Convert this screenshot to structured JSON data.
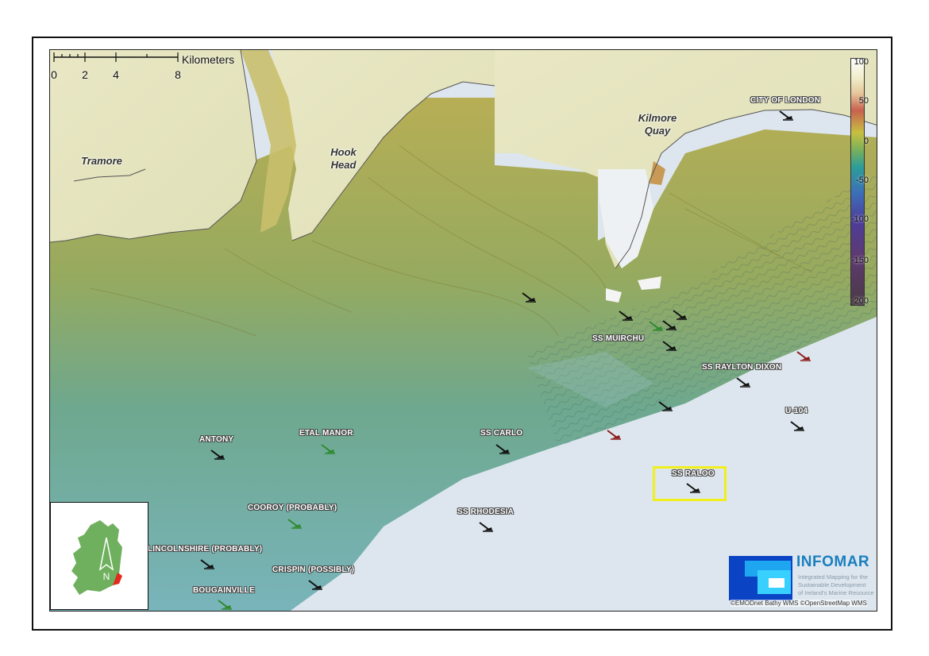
{
  "map": {
    "place_names": [
      {
        "id": "tramore",
        "text": "Tramore"
      },
      {
        "id": "hook-head",
        "text": "Hook\nHead"
      },
      {
        "id": "kilmore-quay",
        "text": "Kilmore\nQuay"
      }
    ],
    "scale": {
      "title": "Kilometers",
      "ticks": [
        "0",
        "2",
        "4",
        "8"
      ]
    },
    "legend": {
      "ticks": [
        "100",
        "50",
        "0",
        "-50",
        "-100",
        "-150",
        "-200"
      ]
    },
    "wrecks": [
      {
        "name": "CITY OF LONDON",
        "status": "black"
      },
      {
        "name": "",
        "status": "black"
      },
      {
        "name": "",
        "status": "black"
      },
      {
        "name": "",
        "status": "green"
      },
      {
        "name": "",
        "status": "black"
      },
      {
        "name": "",
        "status": "black"
      },
      {
        "name": "SS MUIRCHU",
        "status": "black"
      },
      {
        "name": "",
        "status": "red"
      },
      {
        "name": "SS RAYLTON DIXON",
        "status": "black"
      },
      {
        "name": "U-104",
        "status": "black"
      },
      {
        "name": "",
        "status": "black"
      },
      {
        "name": "",
        "status": "red"
      },
      {
        "name": "SS CARLO",
        "status": "black"
      },
      {
        "name": "ETAL MANOR",
        "status": "green"
      },
      {
        "name": "ANTONY",
        "status": "black"
      },
      {
        "name": "SS RALOO",
        "status": "black"
      },
      {
        "name": "SS RHODESIA",
        "status": "black"
      },
      {
        "name": "COOROY (PROBABLY)",
        "status": "green"
      },
      {
        "name": "LINCOLNSHIRE (PROBABLY)",
        "status": "black"
      },
      {
        "name": "CRISPIN (POSSIBLY)",
        "status": "black"
      },
      {
        "name": "BOUGAINVILLE",
        "status": "green"
      }
    ],
    "status_colors": {
      "black": "#111111",
      "green": "#2f8a2f",
      "red": "#8a1a1a"
    },
    "highlighted_wreck": "SS RALOO"
  },
  "inset": {
    "north_label": "N"
  },
  "logo": {
    "name": "INFOMAR",
    "subtitle": [
      "Integrated Mapping for the",
      "Sustainable Development",
      "of Ireland's Marine Resource"
    ]
  },
  "credit": "©EMODnet Bathy WMS ©OpenStreetMap WMS"
}
